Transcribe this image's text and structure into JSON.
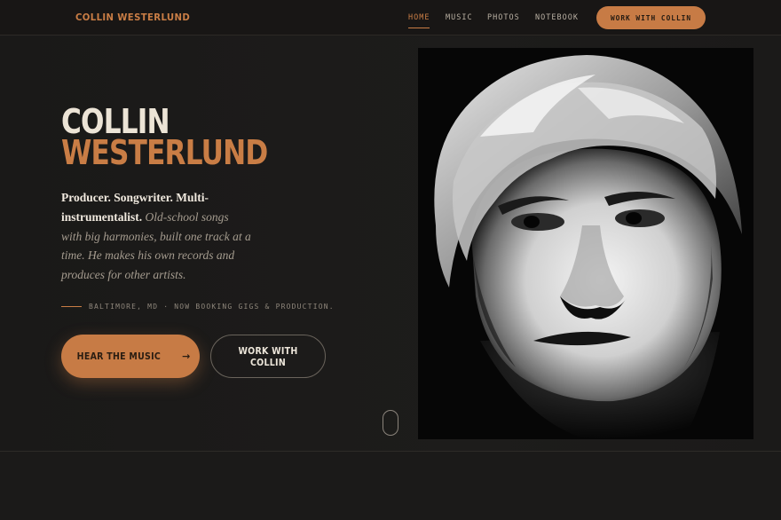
{
  "header": {
    "brand": "COLLIN WESTERLUND",
    "nav": [
      {
        "label": "HOME",
        "active": true
      },
      {
        "label": "MUSIC",
        "active": false
      },
      {
        "label": "PHOTOS",
        "active": false
      },
      {
        "label": "NOTEBOOK",
        "active": false
      }
    ],
    "cta": "WORK WITH COLLIN"
  },
  "hero": {
    "title_line1": "COLLIN",
    "title_line2": "WESTERLUND",
    "desc_strong": "Producer. Songwriter. Multi-instrumentalist.",
    "desc_italic": "Old-school songs with big harmonies, built one track at a time. He makes his own records and produces for other artists.",
    "location": "BALTIMORE, MD · NOW BOOKING GIGS & PRODUCTION.",
    "primary_button": "HEAR THE MUSIC",
    "primary_arrow": "→",
    "secondary_button": "WORK WITH COLLIN"
  },
  "icons": {
    "arrow": "arrow-right-icon",
    "scroll": "scroll-mouse-icon"
  },
  "colors": {
    "accent": "#c77b45",
    "background": "#1b1a19",
    "text": "#e8e1d4"
  }
}
